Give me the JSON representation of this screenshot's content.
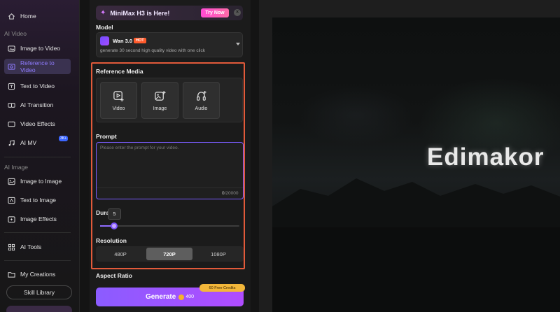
{
  "sidebar": {
    "home": "Home",
    "section_video": "AI Video",
    "items_video": [
      {
        "label": "Image to Video"
      },
      {
        "label": "Reference to Video"
      },
      {
        "label": "Text to Video"
      },
      {
        "label": "AI Transition"
      },
      {
        "label": "Video Effects"
      },
      {
        "label": "AI MV"
      }
    ],
    "ai_mv_badge": "3K+",
    "section_image": "AI Image",
    "items_image": [
      {
        "label": "Image to Image"
      },
      {
        "label": "Text to Image"
      },
      {
        "label": "Image Effects"
      }
    ],
    "ai_tools": "AI Tools",
    "my_creations": "My Creations",
    "skill_library": "Skill Library"
  },
  "banner": {
    "text": "MiniMax H3 is Here!",
    "try_now": "Try Now",
    "close": "×"
  },
  "model": {
    "label": "Model",
    "name": "Wan 3.0",
    "tag": "HOT",
    "description": "generate 30 second high quality video with one click"
  },
  "reference_media": {
    "label": "Reference Media",
    "buttons": [
      "Video",
      "Image",
      "Audio"
    ]
  },
  "prompt": {
    "label": "Prompt",
    "placeholder": "Please enter the prompt for your video.",
    "count_current": "0",
    "count_max": "/20000"
  },
  "duration": {
    "label": "Dura",
    "value": "5",
    "fraction": 0.1
  },
  "resolution": {
    "label": "Resolution",
    "options": [
      "480P",
      "720P",
      "1080P"
    ],
    "selected": "720P"
  },
  "aspect_ratio": {
    "label": "Aspect Ratio"
  },
  "generate": {
    "label": "Generate",
    "cost": "400",
    "free_credits": "60 Free Credits"
  },
  "preview": {
    "brand": "Edimakor"
  },
  "colors": {
    "accent": "#8f6cff",
    "highlight_border": "#e25a3a",
    "hot_tag": "#ff5a2b",
    "try_now": "#ff4bd3"
  }
}
